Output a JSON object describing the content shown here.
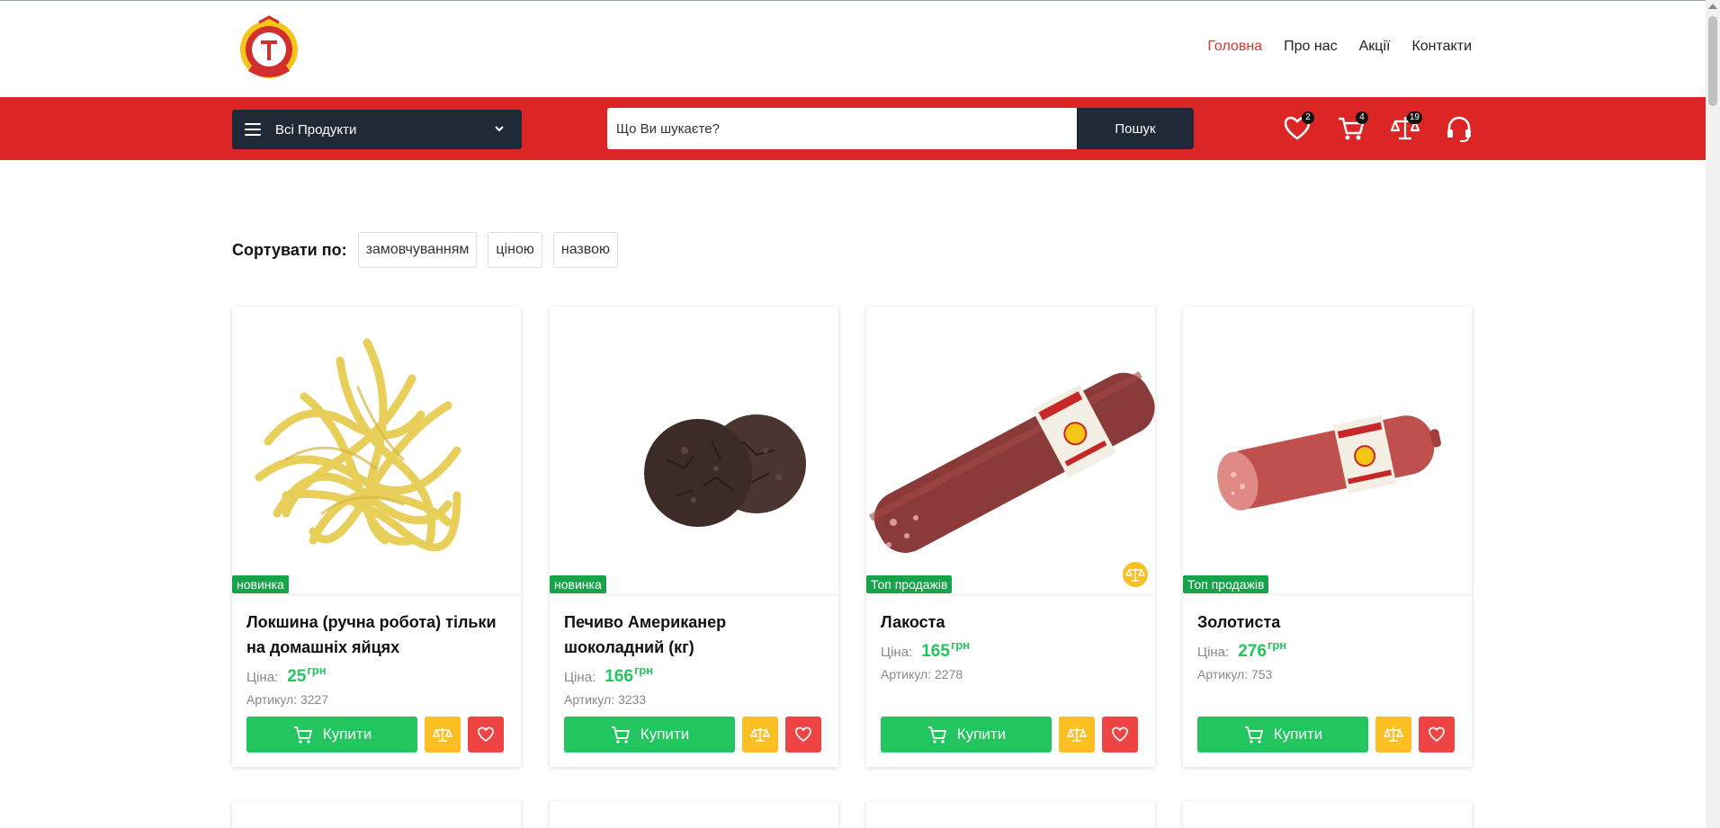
{
  "nav": {
    "items": [
      {
        "label": "Головна",
        "active": true
      },
      {
        "label": "Про нас",
        "active": false
      },
      {
        "label": "Акції",
        "active": false
      },
      {
        "label": "Контакти",
        "active": false
      }
    ]
  },
  "toolbar": {
    "category_label": "Всі Продукти",
    "search_placeholder": "Що Ви шукаєте?",
    "search_button": "Пошук",
    "favorites_count": "2",
    "cart_count": "4",
    "compare_count": "19"
  },
  "sort": {
    "label": "Сортувати по:",
    "options": [
      "замовчуванням",
      "ціною",
      "назвою"
    ]
  },
  "products": [
    {
      "title": "Локшина (ручна робота) тільки на домашніх яйцях",
      "tag": "новинка",
      "price_label": "Ціна:",
      "price": "25",
      "currency": "грн",
      "sku": "Артикул: 3227",
      "buy_label": "Купити",
      "image": "noodles"
    },
    {
      "title": "Печиво Американер шоколадний (кг)",
      "tag": "новинка",
      "price_label": "Ціна:",
      "price": "166",
      "currency": "грн",
      "sku": "Артикул: 3233",
      "buy_label": "Купити",
      "image": "cookies"
    },
    {
      "title": "Лакоста",
      "tag": "Топ продажів",
      "price_label": "Ціна:",
      "price": "165",
      "currency": "грн",
      "sku": "Артикул: 2278",
      "buy_label": "Купити",
      "image": "sausage-long"
    },
    {
      "title": "Золотиста",
      "tag": "Топ продажів",
      "price_label": "Ціна:",
      "price": "276",
      "currency": "грн",
      "sku": "Артикул: 753",
      "buy_label": "Купити",
      "image": "sausage-short"
    }
  ],
  "colors": {
    "brand_red": "#dc2626",
    "dark": "#1f2937",
    "green": "#22c55e",
    "yellow": "#fbbf24"
  }
}
